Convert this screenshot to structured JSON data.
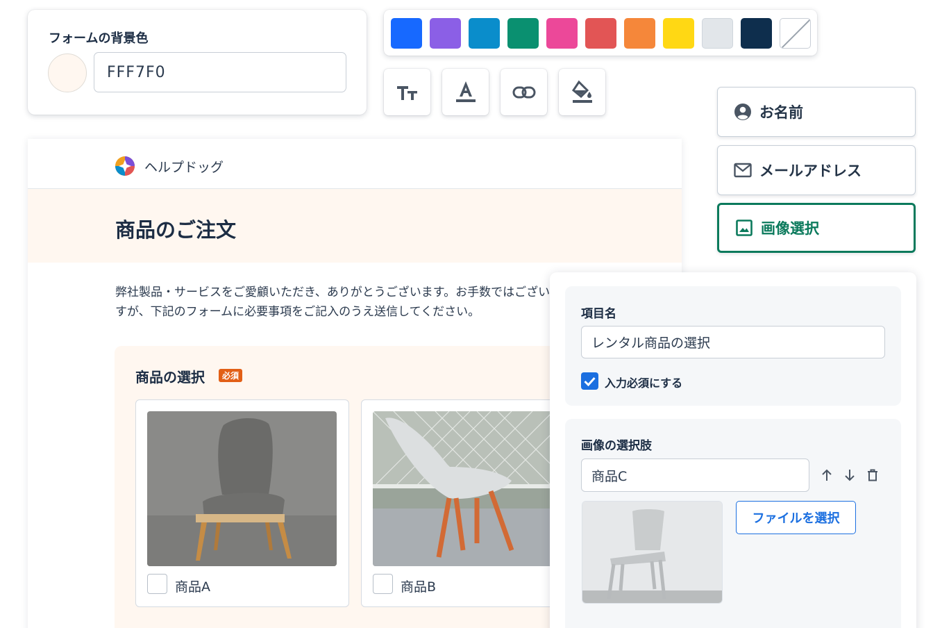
{
  "bg_panel": {
    "title": "フォームの背景色",
    "hex_value": "FFF7F0",
    "swatch_color": "#FFF7F0"
  },
  "palette": {
    "colors": [
      "#1769FF",
      "#8B5FE6",
      "#0A8DCB",
      "#0A9070",
      "#EC4899",
      "#E25555",
      "#F5873A",
      "#FFD814",
      "#E2E6EA",
      "#0E2E4D"
    ],
    "has_none_option": true
  },
  "tools": [
    {
      "name": "text-size",
      "icon": "text-size-icon"
    },
    {
      "name": "text-color",
      "icon": "text-color-icon"
    },
    {
      "name": "link",
      "icon": "link-icon"
    },
    {
      "name": "fill-color",
      "icon": "paint-bucket-icon"
    }
  ],
  "field_types": [
    {
      "label": "お名前",
      "icon": "person-icon"
    },
    {
      "label": "メールアドレス",
      "icon": "mail-icon"
    },
    {
      "label": "画像選択",
      "icon": "image-icon"
    }
  ],
  "form": {
    "brand_name": "ヘルプドッグ",
    "title": "商品のご注文",
    "intro": "弊社製品・サービスをご愛顧いただき、ありがとうございます。お手数ではございますが、下記のフォームに必要事項をご記入のうえ送信してください。",
    "section_title": "商品の選択",
    "required_badge": "必須",
    "products": [
      {
        "label": "商品A"
      },
      {
        "label": "商品B"
      }
    ]
  },
  "settings": {
    "item_name_label": "項目名",
    "item_name_value": "レンタル商品の選択",
    "required_label": "入力必須にする",
    "required_checked": true,
    "options_label": "画像の選択肢",
    "option_value": "商品C",
    "file_button": "ファイルを選択"
  }
}
